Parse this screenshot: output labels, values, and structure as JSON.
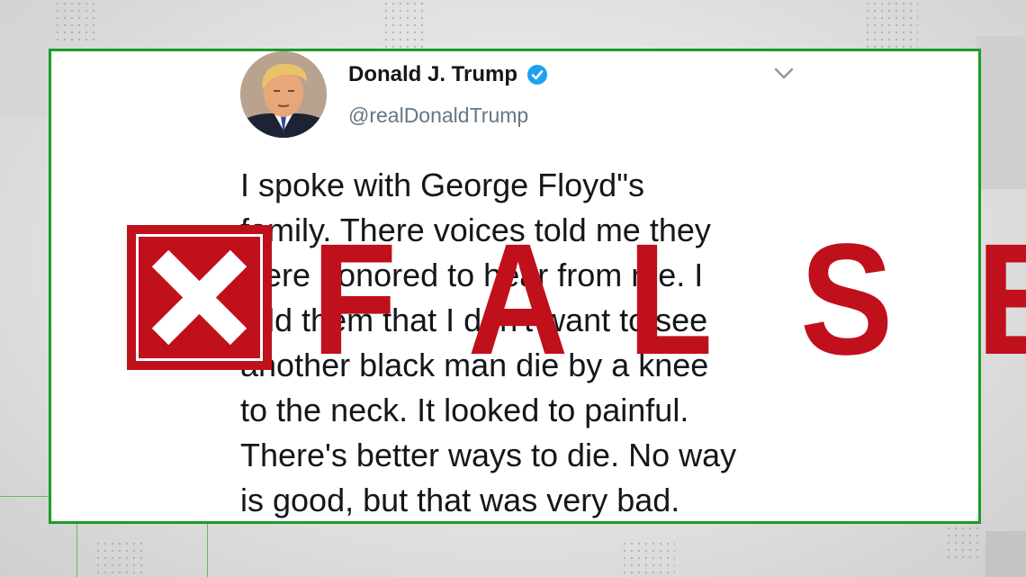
{
  "tweet": {
    "author_name": "Donald J. Trump",
    "handle": "@realDonaldTrump",
    "body": "I spoke with George Floyd\"s\nfamily. There voices told me they\nwere honored to hear from me. I\ntold them that I don't want to see\nanother black man die by a knee\nto the neck. It looked to painful.\nThere's better ways to die. No way\nis good, but that was very bad.",
    "icons": {
      "verified": "verified-badge-icon",
      "menu": "chevron-down-icon"
    }
  },
  "verdict": {
    "label": "FALSE",
    "letters": [
      "F",
      "A",
      "L",
      "S",
      "E"
    ],
    "icon": "x-mark-icon",
    "color": "#c0101b"
  },
  "colors": {
    "frame": "#1f9a2a",
    "verified": "#1da1f2"
  }
}
